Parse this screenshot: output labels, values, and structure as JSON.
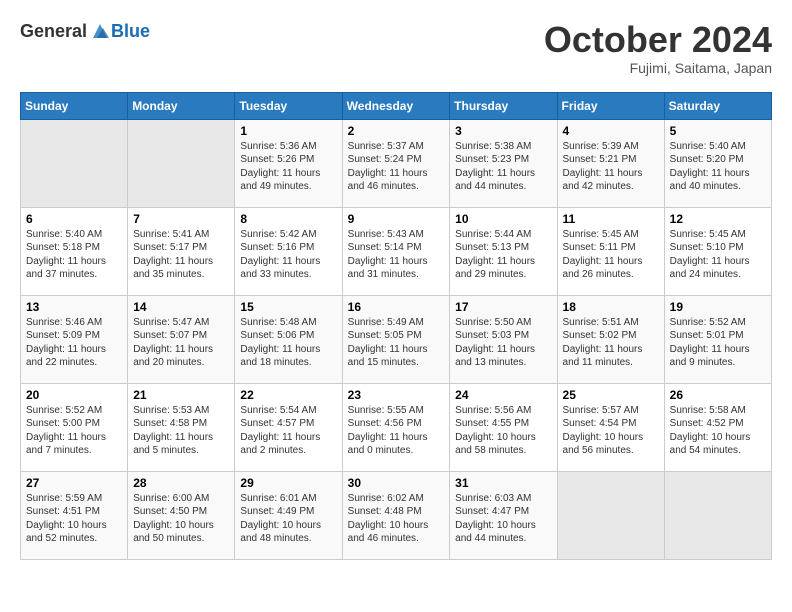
{
  "header": {
    "logo_general": "General",
    "logo_blue": "Blue",
    "month_title": "October 2024",
    "location": "Fujimi, Saitama, Japan"
  },
  "days_of_week": [
    "Sunday",
    "Monday",
    "Tuesday",
    "Wednesday",
    "Thursday",
    "Friday",
    "Saturday"
  ],
  "weeks": [
    [
      {
        "day": "",
        "info": ""
      },
      {
        "day": "",
        "info": ""
      },
      {
        "day": "1",
        "info": "Sunrise: 5:36 AM\nSunset: 5:26 PM\nDaylight: 11 hours and 49 minutes."
      },
      {
        "day": "2",
        "info": "Sunrise: 5:37 AM\nSunset: 5:24 PM\nDaylight: 11 hours and 46 minutes."
      },
      {
        "day": "3",
        "info": "Sunrise: 5:38 AM\nSunset: 5:23 PM\nDaylight: 11 hours and 44 minutes."
      },
      {
        "day": "4",
        "info": "Sunrise: 5:39 AM\nSunset: 5:21 PM\nDaylight: 11 hours and 42 minutes."
      },
      {
        "day": "5",
        "info": "Sunrise: 5:40 AM\nSunset: 5:20 PM\nDaylight: 11 hours and 40 minutes."
      }
    ],
    [
      {
        "day": "6",
        "info": "Sunrise: 5:40 AM\nSunset: 5:18 PM\nDaylight: 11 hours and 37 minutes."
      },
      {
        "day": "7",
        "info": "Sunrise: 5:41 AM\nSunset: 5:17 PM\nDaylight: 11 hours and 35 minutes."
      },
      {
        "day": "8",
        "info": "Sunrise: 5:42 AM\nSunset: 5:16 PM\nDaylight: 11 hours and 33 minutes."
      },
      {
        "day": "9",
        "info": "Sunrise: 5:43 AM\nSunset: 5:14 PM\nDaylight: 11 hours and 31 minutes."
      },
      {
        "day": "10",
        "info": "Sunrise: 5:44 AM\nSunset: 5:13 PM\nDaylight: 11 hours and 29 minutes."
      },
      {
        "day": "11",
        "info": "Sunrise: 5:45 AM\nSunset: 5:11 PM\nDaylight: 11 hours and 26 minutes."
      },
      {
        "day": "12",
        "info": "Sunrise: 5:45 AM\nSunset: 5:10 PM\nDaylight: 11 hours and 24 minutes."
      }
    ],
    [
      {
        "day": "13",
        "info": "Sunrise: 5:46 AM\nSunset: 5:09 PM\nDaylight: 11 hours and 22 minutes."
      },
      {
        "day": "14",
        "info": "Sunrise: 5:47 AM\nSunset: 5:07 PM\nDaylight: 11 hours and 20 minutes."
      },
      {
        "day": "15",
        "info": "Sunrise: 5:48 AM\nSunset: 5:06 PM\nDaylight: 11 hours and 18 minutes."
      },
      {
        "day": "16",
        "info": "Sunrise: 5:49 AM\nSunset: 5:05 PM\nDaylight: 11 hours and 15 minutes."
      },
      {
        "day": "17",
        "info": "Sunrise: 5:50 AM\nSunset: 5:03 PM\nDaylight: 11 hours and 13 minutes."
      },
      {
        "day": "18",
        "info": "Sunrise: 5:51 AM\nSunset: 5:02 PM\nDaylight: 11 hours and 11 minutes."
      },
      {
        "day": "19",
        "info": "Sunrise: 5:52 AM\nSunset: 5:01 PM\nDaylight: 11 hours and 9 minutes."
      }
    ],
    [
      {
        "day": "20",
        "info": "Sunrise: 5:52 AM\nSunset: 5:00 PM\nDaylight: 11 hours and 7 minutes."
      },
      {
        "day": "21",
        "info": "Sunrise: 5:53 AM\nSunset: 4:58 PM\nDaylight: 11 hours and 5 minutes."
      },
      {
        "day": "22",
        "info": "Sunrise: 5:54 AM\nSunset: 4:57 PM\nDaylight: 11 hours and 2 minutes."
      },
      {
        "day": "23",
        "info": "Sunrise: 5:55 AM\nSunset: 4:56 PM\nDaylight: 11 hours and 0 minutes."
      },
      {
        "day": "24",
        "info": "Sunrise: 5:56 AM\nSunset: 4:55 PM\nDaylight: 10 hours and 58 minutes."
      },
      {
        "day": "25",
        "info": "Sunrise: 5:57 AM\nSunset: 4:54 PM\nDaylight: 10 hours and 56 minutes."
      },
      {
        "day": "26",
        "info": "Sunrise: 5:58 AM\nSunset: 4:52 PM\nDaylight: 10 hours and 54 minutes."
      }
    ],
    [
      {
        "day": "27",
        "info": "Sunrise: 5:59 AM\nSunset: 4:51 PM\nDaylight: 10 hours and 52 minutes."
      },
      {
        "day": "28",
        "info": "Sunrise: 6:00 AM\nSunset: 4:50 PM\nDaylight: 10 hours and 50 minutes."
      },
      {
        "day": "29",
        "info": "Sunrise: 6:01 AM\nSunset: 4:49 PM\nDaylight: 10 hours and 48 minutes."
      },
      {
        "day": "30",
        "info": "Sunrise: 6:02 AM\nSunset: 4:48 PM\nDaylight: 10 hours and 46 minutes."
      },
      {
        "day": "31",
        "info": "Sunrise: 6:03 AM\nSunset: 4:47 PM\nDaylight: 10 hours and 44 minutes."
      },
      {
        "day": "",
        "info": ""
      },
      {
        "day": "",
        "info": ""
      }
    ]
  ]
}
